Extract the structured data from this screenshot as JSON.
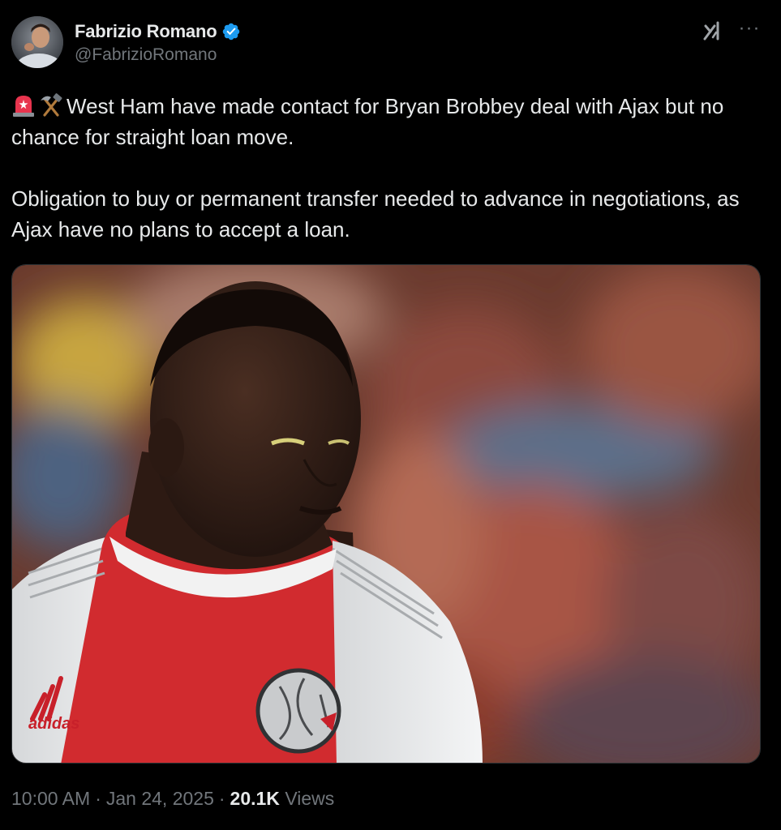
{
  "author": {
    "display_name": "Fabrizio Romano",
    "handle": "@FabrizioRomano",
    "verified": true,
    "verified_color": "#1d9bf0",
    "avatar_icon": "profile-photo"
  },
  "header_actions": {
    "grok_icon": "grok-icon",
    "more_icon": "more-horizontal-icon",
    "more_label": "···"
  },
  "tweet": {
    "emoji_1": "police-car-light-emoji",
    "emoji_2": "hammer-and-pick-emoji",
    "paragraph_1": "West Ham have made contact for Bryan Brobbey deal with Ajax but no chance for straight loan move.",
    "paragraph_2": "Obligation to buy or permanent transfer needed to advance in negotiations, as Ajax have no plans to accept a loan."
  },
  "media": {
    "kind": "photo",
    "badge_text": "adidas"
  },
  "meta": {
    "time": "10:00 AM",
    "separator": "·",
    "date": "Jan 24, 2025",
    "views_count": "20.1K",
    "views_label": "Views"
  },
  "colors": {
    "background": "#000000",
    "text_primary": "#e7e9ea",
    "text_secondary": "#71767b",
    "border": "#2f3336"
  }
}
